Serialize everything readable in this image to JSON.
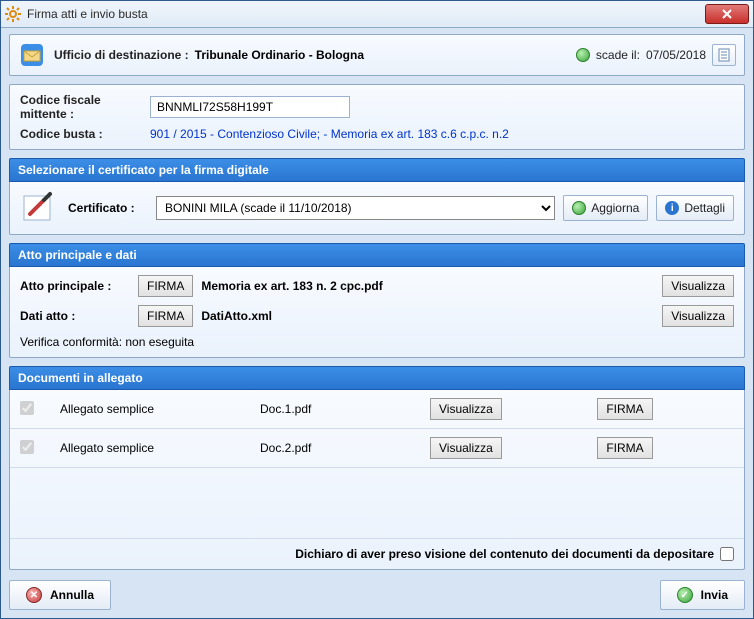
{
  "window": {
    "title": "Firma atti e invio busta"
  },
  "header": {
    "label": "Ufficio di destinazione :",
    "value": "Tribunale Ordinario - Bologna",
    "scade_label": "scade il:",
    "scade_value": "07/05/2018"
  },
  "mittente": {
    "cf_label": "Codice fiscale mittente :",
    "cf_value": "BNNMLI72S58H199T",
    "cb_label": "Codice  busta :",
    "cb_value": "901 / 2015 - Contenzioso Civile; - Memoria ex art. 183 c.6 c.p.c. n.2"
  },
  "cert": {
    "header": "Selezionare il certificato per la firma digitale",
    "label": "Certificato :",
    "selected": "BONINI MILA (scade il 11/10/2018)",
    "aggiorna": "Aggiorna",
    "dettagli": "Dettagli"
  },
  "atto": {
    "header": "Atto principale e dati",
    "principale_label": "Atto principale :",
    "principale_file": "Memoria ex art. 183 n. 2 cpc.pdf",
    "dati_label": "Dati atto :",
    "dati_file": "DatiAtto.xml",
    "firma_btn": "FIRMA",
    "visualizza_btn": "Visualizza",
    "verifica": "Verifica conformità: non eseguita"
  },
  "docs": {
    "header": "Documenti in allegato",
    "rows": [
      {
        "type": "Allegato semplice",
        "file": "Doc.1.pdf"
      },
      {
        "type": "Allegato semplice",
        "file": "Doc.2.pdf"
      }
    ],
    "visualizza_btn": "Visualizza",
    "firma_btn": "FIRMA",
    "declare": "Dichiaro di aver preso visione del contenuto dei documenti da depositare"
  },
  "footer": {
    "annulla": "Annulla",
    "invia": "Invia"
  }
}
